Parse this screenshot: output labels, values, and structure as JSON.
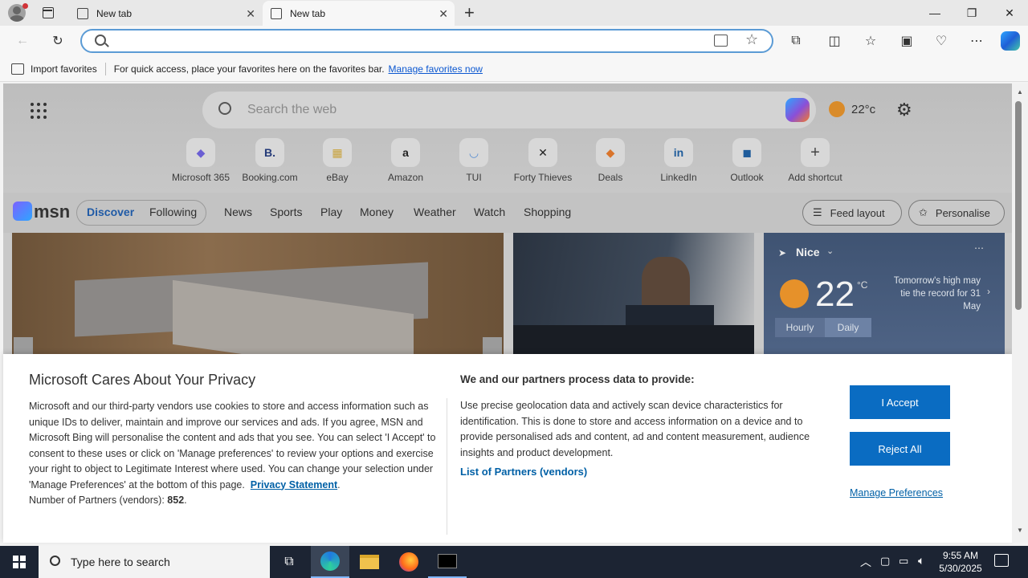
{
  "browser": {
    "tabs": [
      {
        "title": "New tab"
      },
      {
        "title": "New tab"
      }
    ],
    "new_tab_glyph": "+",
    "address_value": "",
    "favorites_bar": {
      "import_label": "Import favorites",
      "message": "For quick access, place your favorites here on the favorites bar.",
      "manage_link": "Manage favorites now"
    }
  },
  "newtab": {
    "search_placeholder": "Search the web",
    "weather_temp": "22°c",
    "shortcuts": [
      {
        "label": "Microsoft 365",
        "color": "#6b5fd3",
        "glyph": "◆"
      },
      {
        "label": "Booking.com",
        "color": "#243a78",
        "glyph": "B."
      },
      {
        "label": "eBay",
        "color": "#c8a23b",
        "glyph": "▦"
      },
      {
        "label": "Amazon",
        "color": "#222222",
        "glyph": "a"
      },
      {
        "label": "TUI",
        "color": "#5b8fd1",
        "glyph": "◡"
      },
      {
        "label": "Forty Thieves",
        "color": "#222222",
        "glyph": "✕"
      },
      {
        "label": "Deals",
        "color": "#d9742b",
        "glyph": "◆"
      },
      {
        "label": "LinkedIn",
        "color": "#1f5c9b",
        "glyph": "in"
      },
      {
        "label": "Outlook",
        "color": "#1f5c9b",
        "glyph": "◼"
      },
      {
        "label": "Add shortcut",
        "color": "#d8d8d8",
        "glyph": "+"
      }
    ],
    "brand": "msn",
    "nav_active": "Discover",
    "nav_following": "Following",
    "nav_links": [
      "News",
      "Sports",
      "Play",
      "Money",
      "Weather",
      "Watch",
      "Shopping"
    ],
    "feed_layout": "Feed layout",
    "personalise": "Personalise",
    "weather_card": {
      "location": "Nice",
      "temp": "22",
      "unit": "°C",
      "headline": "Tomorrow's high may tie the record for 31 May",
      "tab_hourly": "Hourly",
      "tab_daily": "Daily"
    }
  },
  "privacy": {
    "title": "Microsoft Cares About Your Privacy",
    "body": "Microsoft and our third-party vendors use cookies to store and access information such as unique IDs to deliver, maintain and improve our services and ads. If you agree, MSN and Microsoft Bing will personalise the content and ads that you see. You can select 'I Accept' to consent to these uses or click on 'Manage preferences' to review your options and exercise your right to object to Legitimate Interest where used. You can change your selection under 'Manage Preferences' at the bottom of this page.",
    "privacy_link": "Privacy Statement",
    "partners_prefix": "Number of Partners (vendors):",
    "partners_count": "852",
    "heading2": "We and our partners process data to provide:",
    "body2": "Use precise geolocation data and actively scan device characteristics for identification. This is done to store and access information on a device and to provide personalised ads and content, ad and content measurement, audience insights and product development.",
    "partners_link": "List of Partners (vendors)",
    "accept": "I Accept",
    "reject": "Reject All",
    "manage": "Manage Preferences"
  },
  "taskbar": {
    "search_placeholder": "Type here to search",
    "time": "9:55 AM",
    "date": "5/30/2025"
  }
}
